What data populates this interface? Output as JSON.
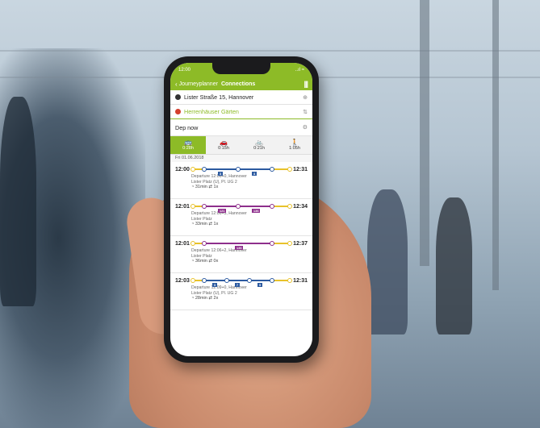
{
  "status": {
    "time": "12:00",
    "signal": "..ıl ≈"
  },
  "navbar": {
    "back_label": "Journeyplanner",
    "title": "Connections",
    "menu_icon": "|||"
  },
  "search": {
    "from": "Lister Straße 15, Hannover",
    "to": "Herrenhäuser Gärten",
    "departure": "Dep now"
  },
  "modes": [
    {
      "icon": "🚌",
      "name": "public-transport",
      "duration": "0:28h",
      "active": true
    },
    {
      "icon": "🚗",
      "name": "car",
      "duration": "0:15h",
      "active": false
    },
    {
      "icon": "🚲",
      "name": "bike",
      "duration": "0:21h",
      "active": false
    },
    {
      "icon": "🚶",
      "name": "walk",
      "duration": "1:05h",
      "active": false
    }
  ],
  "date": "Fri 01.06.2018",
  "connections": [
    {
      "dep": "12:00",
      "arr": "12:31",
      "departure_text": "Departure 12:06+0, Hannover",
      "place": "Lister Platz (U), Pl. UG 2",
      "duration": "31min",
      "changes": "1x",
      "lines": [
        "3",
        "4"
      ],
      "color": "#2c5aa0",
      "delay_red": false
    },
    {
      "dep": "12:01",
      "arr": "12:34",
      "departure_text": "Departure 12:06+3, Hannover",
      "place": "Lister Platz",
      "duration": "33min",
      "changes": "1x",
      "lines": [
        "121",
        "136"
      ],
      "color": "#8e2f8c",
      "delay_red": true
    },
    {
      "dep": "12:01",
      "arr": "12:37",
      "departure_text": "Departure 12:06+2, Hannover",
      "place": "Lister Platz",
      "duration": "36min",
      "changes": "0x",
      "lines": [
        "136"
      ],
      "color": "#8e2f8c",
      "delay_red": true
    },
    {
      "dep": "12:03",
      "arr": "12:31",
      "departure_text": "Departure 12:09+0, Hannover",
      "place": "Lister Platz (U), Pl. UG 2",
      "duration": "28min",
      "changes": "2x",
      "lines": [
        "3",
        "7",
        "5"
      ],
      "color": "#2c5aa0",
      "delay_red": false
    }
  ],
  "colors": {
    "accent": "#8dbb27",
    "bus": "#8e2f8c",
    "tram": "#2c5aa0",
    "walk": "#e8c22b"
  }
}
